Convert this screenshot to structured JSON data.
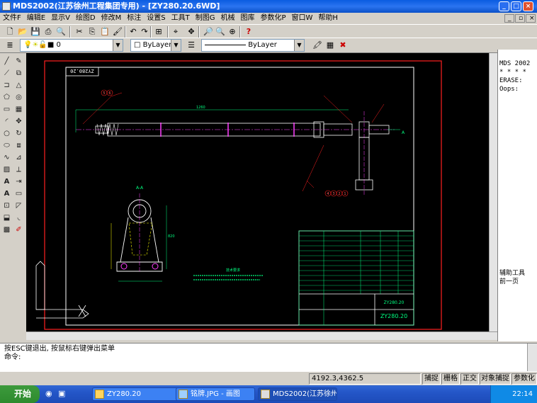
{
  "window": {
    "title": "MDS2002(江苏徐州工程集团专用) - [ZY280.20.6WD]",
    "min": "_",
    "max": "□",
    "close": "×"
  },
  "menu": [
    "文件F",
    "编辑E",
    "显示V",
    "绘图D",
    "修改M",
    "标注",
    "设置S",
    "工具T",
    "制图G",
    "机械",
    "图库",
    "参数化P",
    "窗口W",
    "帮助H"
  ],
  "layer": {
    "current": "0",
    "color_combo": "ByLayer",
    "linetype_combo": "ByLayer"
  },
  "drawing": {
    "title_stamp": "ZY280.20",
    "section_label": "A-A",
    "view_label": "A",
    "title_block_name": "ZY280.20",
    "title_block_part": "ZY280.20",
    "notes_title": "技术要求",
    "balloons": [
      "5",
      "6",
      "4",
      "3",
      "2",
      "1",
      "8",
      "7"
    ],
    "dim_overall": "1260",
    "dim_height": "820"
  },
  "text_window": [
    "MDS 2002",
    "* * * *",
    "ERASE:",
    "",
    "Oops:"
  ],
  "text_window_footer": [
    "辅助工具",
    "前一页"
  ],
  "command": {
    "line1": "按ESC键退出, 按鼠标右键弹出菜单",
    "line2": "命令:"
  },
  "status": {
    "coords": "4192.3,4362.5",
    "toggles": [
      "捕捉",
      "栅格",
      "正交",
      "对象捕捉",
      "参数化"
    ]
  },
  "taskbar": {
    "start": "开始",
    "tasks": [
      "ZY280.20",
      "铭牌.JPG - 画图",
      "MDS2002(江苏徐州..."
    ],
    "clock": "22:14"
  },
  "colors": {
    "canvas": "#000000",
    "frame": "#ff0000",
    "title_block": "#00ff00",
    "accent": "#00ffff"
  }
}
